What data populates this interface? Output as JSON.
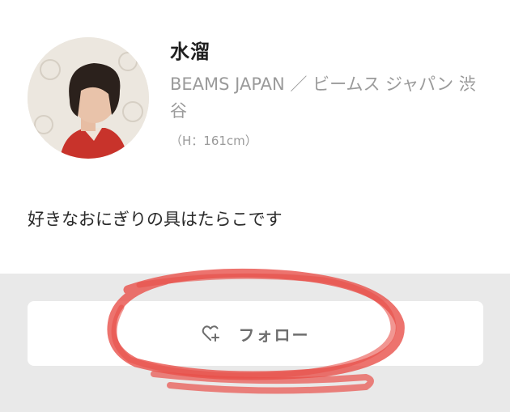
{
  "profile": {
    "name": "水溜",
    "shop": "BEAMS JAPAN ／ ビームス ジャパン 渋谷",
    "height": "（H：161cm）",
    "bio": "好きなおにぎりの具はたらこです"
  },
  "follow": {
    "label": "フォロー",
    "icon": "heart-plus-icon"
  },
  "colors": {
    "annotation": "#e8504a",
    "section_bg": "#e9e9e9",
    "button_bg": "#ffffff"
  }
}
